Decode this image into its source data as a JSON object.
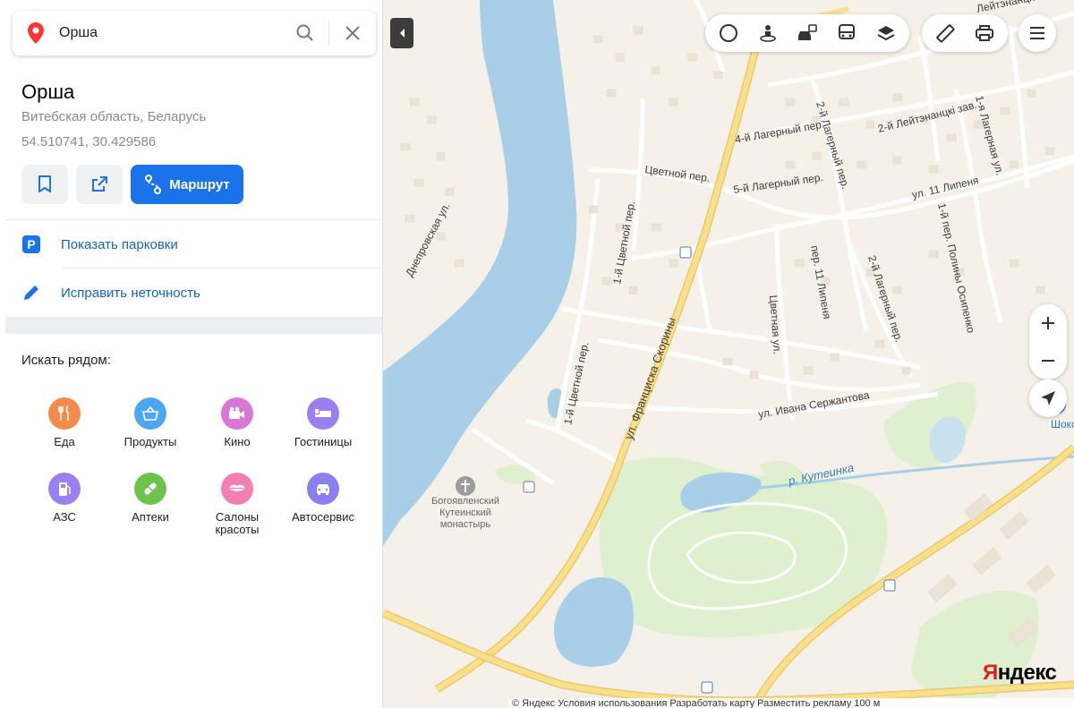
{
  "search": {
    "value": "Орша"
  },
  "place": {
    "title": "Орша",
    "region": "Витебская область, Беларусь",
    "coords": "54.510741, 30.429586"
  },
  "actions": {
    "route_label": "Маршрут"
  },
  "links": {
    "parking": "Показать парковки",
    "report": "Исправить неточность"
  },
  "nearby": {
    "title": "Искать рядом:",
    "categories": [
      {
        "label": "Еда",
        "color": "#f7894a",
        "icon": "fork-knife-icon"
      },
      {
        "label": "Продукты",
        "color": "#4da6f0",
        "icon": "basket-icon"
      },
      {
        "label": "Кино",
        "color": "#d977d6",
        "icon": "camera-icon"
      },
      {
        "label": "Гостиницы",
        "color": "#9a7ff0",
        "icon": "bed-icon"
      },
      {
        "label": "АЗС",
        "color": "#9a7ff0",
        "icon": "fuel-icon"
      },
      {
        "label": "Аптеки",
        "color": "#6cc24a",
        "icon": "pill-icon"
      },
      {
        "label": "Салоны красоты",
        "color": "#f27fb2",
        "icon": "lips-icon"
      },
      {
        "label": "Автосервис",
        "color": "#8a7ff0",
        "icon": "car-service-icon"
      }
    ]
  },
  "map": {
    "streets": {
      "s1": "Днепровская ул.",
      "s2": "1-й Цветной пер.",
      "s3": "1-й Цветной пер.",
      "s4": "Цветной пер.",
      "s5": "ул. Франциска Скорины",
      "s6": "4-й Лагерный пер.",
      "s7": "5-й Лагерный пер.",
      "s8": "2-й Лагерный пер.",
      "s9": "2-й Лагерный пер.",
      "s10": "2-й Лейтэнанцкі зав.",
      "s11": "1-я Лагерная ул.",
      "s12": "ул. 11 Липеня",
      "s13": "1-й пер. Полины Осипенко",
      "s14": "пер. 11 Липеня",
      "s15": "Цветная ул.",
      "s16": "ул. Ивана Сержантова",
      "s17": "р. Кутеинка",
      "s18": "Лейтэнанцкі",
      "s19": "Шоко"
    },
    "poi": {
      "monastery_line1": "Богоявленский",
      "monastery_line2": "Кутеинский",
      "monastery_line3": "монастырь"
    },
    "logo_red": "Я",
    "logo_black": "ндекс",
    "footer": "© Яндекс Условия использования    Разработать карту    Разместить рекламу    100 м"
  },
  "colors": {
    "land": "#f5f1e8",
    "water": "#a9cfe8",
    "park": "#dff0cf",
    "road_major": "#fbe08a",
    "building": "#ebe4d6",
    "accent": "#1a73e8"
  }
}
